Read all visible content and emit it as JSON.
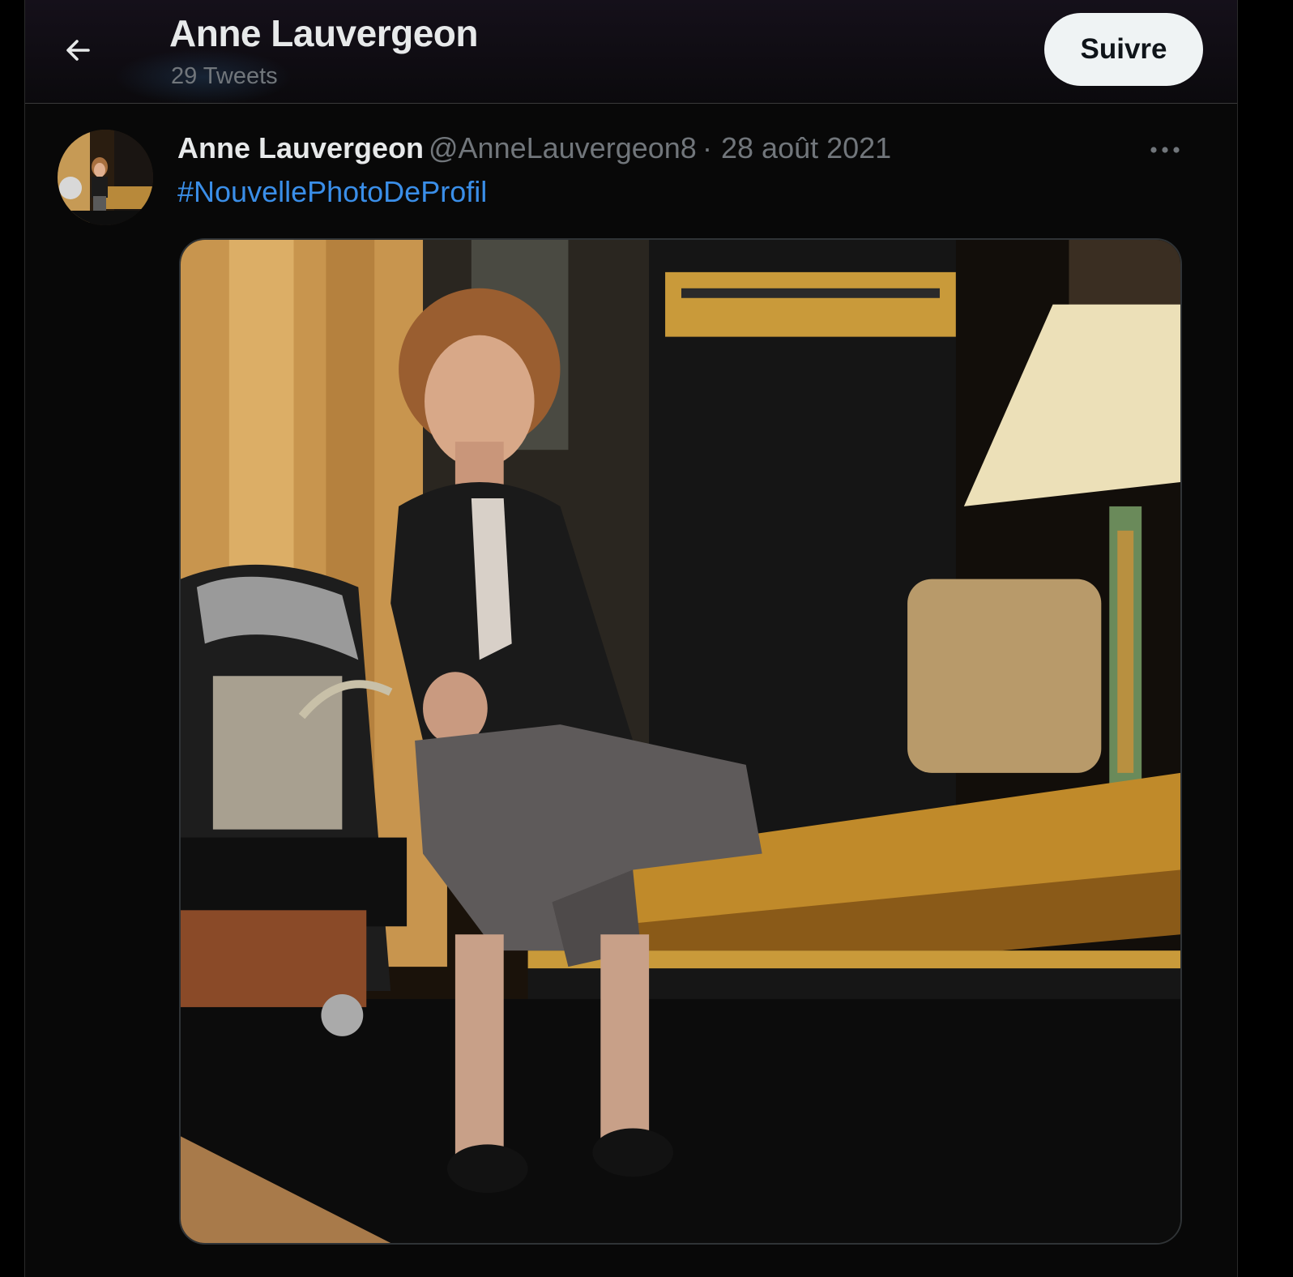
{
  "header": {
    "title": "Anne Lauvergeon",
    "tweet_count": "29 Tweets",
    "follow_label": "Suivre",
    "back_icon": "arrow-left-icon"
  },
  "tweet": {
    "author_name": "Anne Lauvergeon",
    "handle": "@AnneLauvergeon8",
    "separator": "·",
    "date": "28 août 2021",
    "text": "#NouvellePhotoDeProfil",
    "more_icon": "more-horizontal-icon",
    "media_description": "profile photo"
  },
  "colors": {
    "background": "#000000",
    "column_bg": "#080808",
    "primary_text": "#e7e9ea",
    "secondary_text": "#71767b",
    "link": "#3a8ee8",
    "follow_button_bg": "#eff3f4"
  }
}
